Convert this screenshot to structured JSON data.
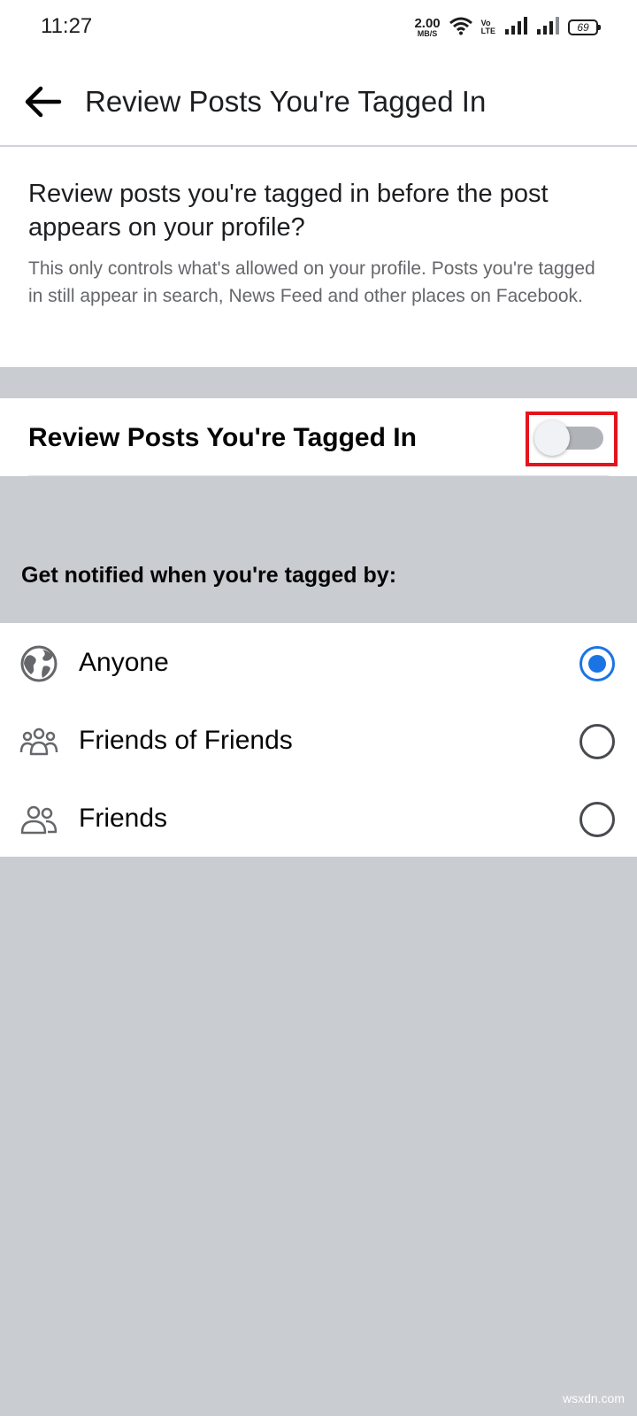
{
  "status": {
    "time": "11:27",
    "net_speed_value": "2.00",
    "net_speed_unit": "MB/S",
    "volte_top": "Vo",
    "volte_bottom": "LTE",
    "battery": "69"
  },
  "header": {
    "title": "Review Posts You're Tagged In",
    "back_icon": "arrow-left-icon"
  },
  "intro": {
    "question": "Review posts you're tagged in before the post appears on your profile?",
    "description": "This only controls what's allowed on your profile. Posts you're tagged in still appear in search, News Feed and other places on Facebook."
  },
  "toggle": {
    "label": "Review Posts You're Tagged In",
    "state": "off",
    "highlight_color": "#e4141c"
  },
  "notify": {
    "heading": "Get notified when you're tagged by:",
    "options": [
      {
        "label": "Anyone",
        "icon": "globe-icon",
        "selected": true
      },
      {
        "label": "Friends of Friends",
        "icon": "friends-of-friends-icon",
        "selected": false
      },
      {
        "label": "Friends",
        "icon": "friends-icon",
        "selected": false
      }
    ]
  },
  "colors": {
    "accent": "#1b74e4",
    "background": "#c9ccd1",
    "secondary_text": "#65676b"
  },
  "watermark": "wsxdn.com"
}
